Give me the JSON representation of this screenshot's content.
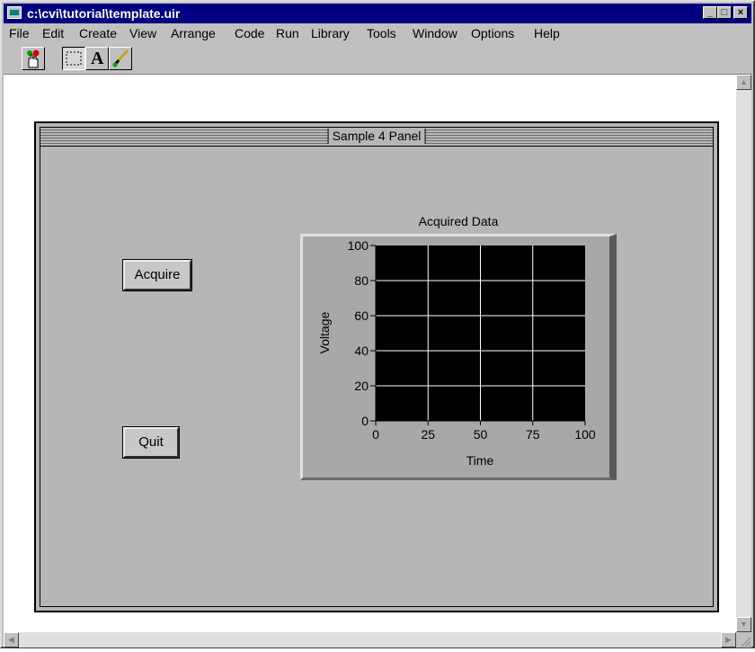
{
  "window": {
    "title": "c:\\cvi\\tutorial\\template.uir",
    "min_label": "_",
    "max_label": "□",
    "close_label": "×"
  },
  "menu": [
    "File",
    "Edit",
    "Create",
    "View",
    "Arrange",
    "Code",
    "Run",
    "Library",
    "Tools",
    "Window",
    "Options",
    "Help"
  ],
  "toolbar": {
    "tools": [
      {
        "name": "operate-tool",
        "icon": "hand-pointer-icon"
      },
      {
        "name": "select-tool",
        "icon": "selection-rectangle-icon",
        "pressed": true
      },
      {
        "name": "text-tool",
        "icon": "letter-a-icon",
        "label": "A"
      },
      {
        "name": "color-tool",
        "icon": "paintbrush-icon"
      }
    ]
  },
  "panel": {
    "title": "Sample 4 Panel"
  },
  "buttons": {
    "acquire": "Acquire",
    "quit": "Quit"
  },
  "graph": {
    "title": "Acquired Data",
    "xlabel": "Time",
    "ylabel": "Voltage",
    "plot_bg": "#000000",
    "grid_color": "#ffffff"
  },
  "chart_data": {
    "type": "line",
    "title": "Acquired Data",
    "xlabel": "Time",
    "ylabel": "Voltage",
    "xlim": [
      0,
      100
    ],
    "ylim": [
      0,
      100
    ],
    "x_ticks": [
      0,
      25,
      50,
      75,
      100
    ],
    "y_ticks": [
      0,
      20,
      40,
      60,
      80,
      100
    ],
    "grid": true,
    "series": []
  }
}
